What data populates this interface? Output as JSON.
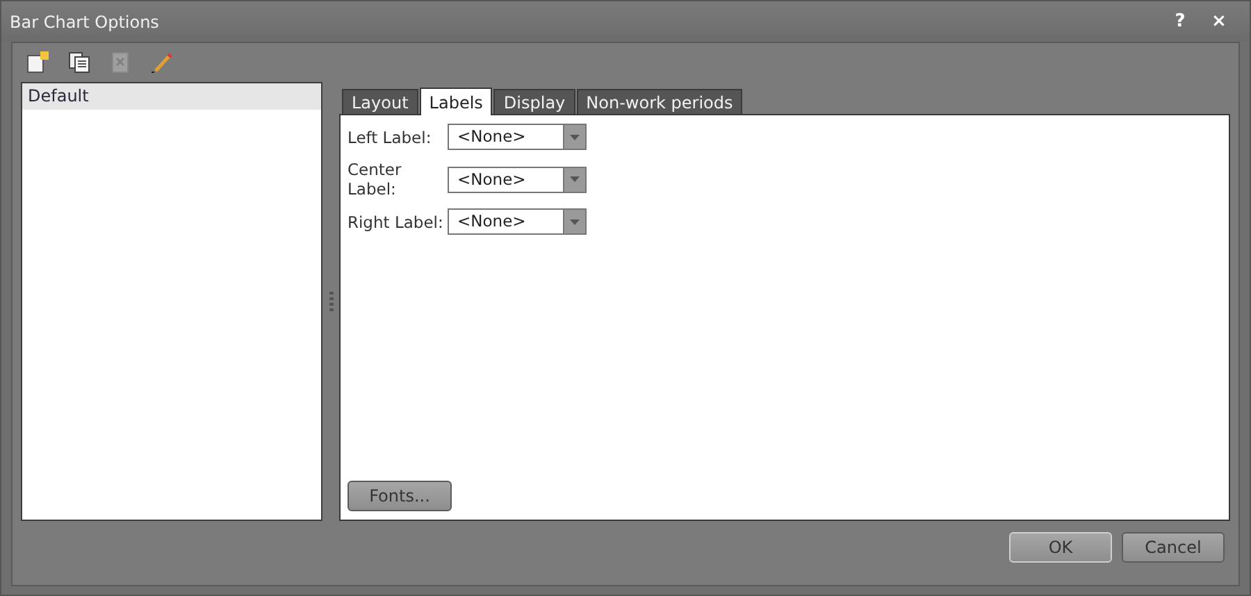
{
  "window": {
    "title": "Bar Chart Options",
    "help_glyph": "?",
    "close_glyph": "×"
  },
  "toolbar": [
    {
      "kind": "new",
      "disabled": false
    },
    {
      "kind": "copy",
      "disabled": false
    },
    {
      "kind": "delete",
      "disabled": true
    },
    {
      "kind": "rename",
      "disabled": false
    }
  ],
  "list": {
    "items": [
      {
        "label": "Default",
        "selected": true
      }
    ]
  },
  "tabs": [
    {
      "label": "Layout",
      "selected": false
    },
    {
      "label": "Labels",
      "selected": true
    },
    {
      "label": "Display",
      "selected": false
    },
    {
      "label": "Non-work periods",
      "selected": false
    }
  ],
  "fields": [
    {
      "label": "Left Label:",
      "value": "<None>"
    },
    {
      "label": "Center Label:",
      "value": "<None>"
    },
    {
      "label": "Right Label:",
      "value": "<None>"
    }
  ],
  "fonts_button": "Fonts...",
  "buttons": [
    {
      "label": "OK",
      "default": true
    },
    {
      "label": "Cancel",
      "default": false
    }
  ]
}
